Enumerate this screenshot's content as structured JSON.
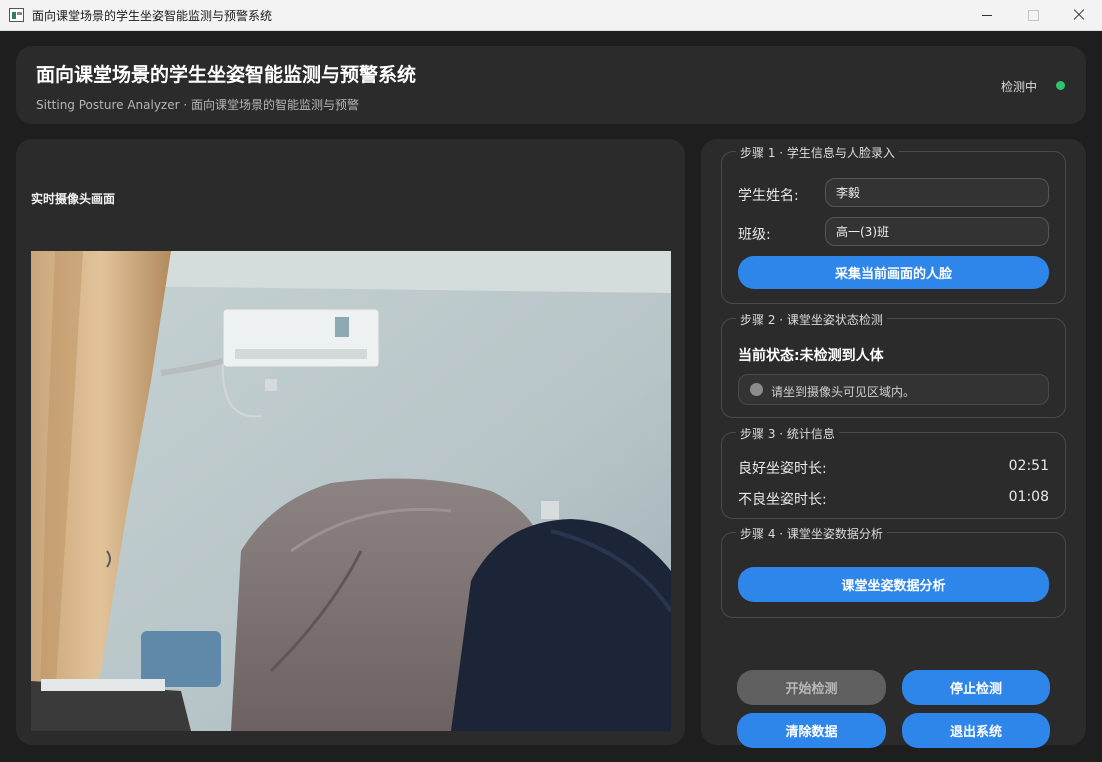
{
  "window": {
    "title": "面向课堂场景的学生坐姿智能监测与预警系统"
  },
  "header": {
    "title": "面向课堂场景的学生坐姿智能监测与预警系统",
    "subtitle": "Sitting Posture Analyzer · 面向课堂场景的智能监测与预警",
    "status": "检测中",
    "status_color": "#2ec46a"
  },
  "camera": {
    "label": "实时摄像头画面"
  },
  "step1": {
    "title": "步骤 1 · 学生信息与人脸录入",
    "name_label": "学生姓名:",
    "name_value": "李毅",
    "class_label": "班级:",
    "class_value": "高一(3)班",
    "capture_button": "采集当前画面的人脸"
  },
  "step2": {
    "title": "步骤 2 · 课堂坐姿状态检测",
    "current_state": "当前状态:未检测到人体",
    "hint": "请坐到摄像头可见区域内。"
  },
  "step3": {
    "title": "步骤 3 · 统计信息",
    "good_label": "良好坐姿时长:",
    "good_value": "02:51",
    "bad_label": "不良坐姿时长:",
    "bad_value": "01:08"
  },
  "step4": {
    "title": "步骤 4 · 课堂坐姿数据分析",
    "analyze_button": "课堂坐姿数据分析"
  },
  "controls": {
    "start": "开始检测",
    "stop": "停止检测",
    "clear": "清除数据",
    "exit": "退出系统"
  },
  "colors": {
    "accent": "#2f86ea",
    "disabled": "#5f5f5f",
    "panel": "#2b2b2b",
    "background": "#1e1e1e"
  }
}
